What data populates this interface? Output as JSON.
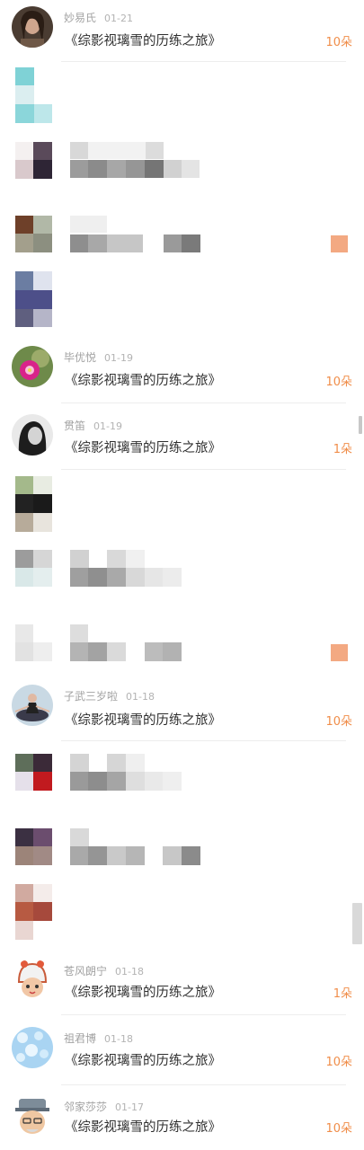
{
  "gift_records": [
    {
      "user": "妙易氏",
      "date": "01-21",
      "gift": "《综影视璃雪的历练之旅》",
      "count": "10朵",
      "avatar_icon": "woman-portrait-avatar"
    },
    {
      "user": "毕优悦",
      "date": "01-19",
      "gift": "《综影视璃雪的历练之旅》",
      "count": "10朵",
      "avatar_icon": "pink-flower-avatar"
    },
    {
      "user": "贯笛",
      "date": "01-19",
      "gift": "《综影视璃雪的历练之旅》",
      "count": "1朵",
      "avatar_icon": "bw-girl-avatar"
    },
    {
      "user": "子武三岁啦",
      "date": "01-18",
      "gift": "《综影视璃雪的历练之旅》",
      "count": "10朵",
      "avatar_icon": "dancer-avatar"
    },
    {
      "user": "苍风朗宁",
      "date": "01-18",
      "gift": "《综影视璃雪的历练之旅》",
      "count": "1朵",
      "avatar_icon": "cartoon-girl-avatar"
    },
    {
      "user": "祖君博",
      "date": "01-18",
      "gift": "《综影视璃雪的历练之旅》",
      "count": "10朵",
      "avatar_icon": "blue-bubbles-avatar"
    },
    {
      "user": "邻家莎莎",
      "date": "01-17",
      "gift": "《综影视璃雪的历练之旅》",
      "count": "10朵",
      "avatar_icon": "cartoon-old-man-avatar"
    }
  ],
  "colors": {
    "accent_count": "#f08d49",
    "title_text": "#2f2f2f",
    "meta_text": "#a2a2a2",
    "divider": "#ededed"
  }
}
